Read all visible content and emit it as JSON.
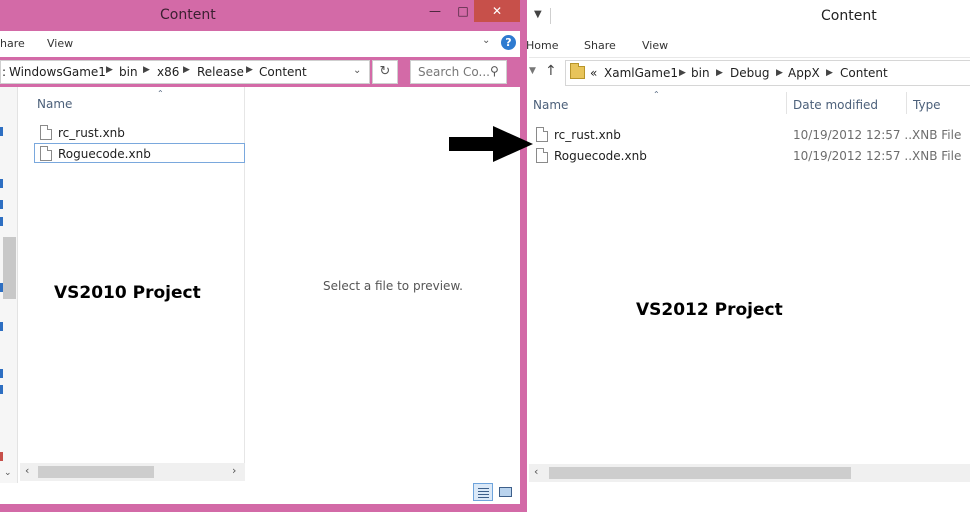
{
  "left_window": {
    "title": "Content",
    "ribbon": {
      "tab_share": "hare",
      "tab_view": "View"
    },
    "address": {
      "c0": ":",
      "c1": "WindowsGame1",
      "c2": "bin",
      "c3": "x86",
      "c4": "Release",
      "c5": "Content"
    },
    "search_placeholder": "Search Co...",
    "columns": {
      "name": "Name"
    },
    "files": [
      {
        "name": "rc_rust.xnb"
      },
      {
        "name": "Roguecode.xnb"
      }
    ],
    "preview_message": "Select a file to preview.",
    "overlay_label": "VS2010 Project"
  },
  "right_window": {
    "title": "Content",
    "ribbon": {
      "tab_home": "Home",
      "tab_share": "Share",
      "tab_view": "View"
    },
    "address": {
      "overflow": "«",
      "c1": "XamlGame1",
      "c2": "bin",
      "c3": "Debug",
      "c4": "AppX",
      "c5": "Content"
    },
    "columns": {
      "name": "Name",
      "date": "Date modified",
      "type": "Type"
    },
    "files": [
      {
        "name": "rc_rust.xnb",
        "date": "10/19/2012 12:57 ...",
        "type": "XNB File"
      },
      {
        "name": "Roguecode.xnb",
        "date": "10/19/2012 12:57 ...",
        "type": "XNB File"
      }
    ],
    "overlay_label": "VS2012 Project"
  },
  "icons": {
    "close": "close-icon",
    "maximize": "maximize-icon",
    "minimize": "minimize-icon",
    "help": "help-icon",
    "refresh": "refresh-icon",
    "search": "search-icon",
    "up": "up-arrow-icon",
    "folder": "folder-icon",
    "file": "file-icon",
    "arrow": "black-arrow-icon"
  },
  "colors": {
    "left_frame": "#d36aa7",
    "close_button": "#c7504a",
    "selection_border": "#7aa8dd",
    "column_header": "#4c607a"
  }
}
